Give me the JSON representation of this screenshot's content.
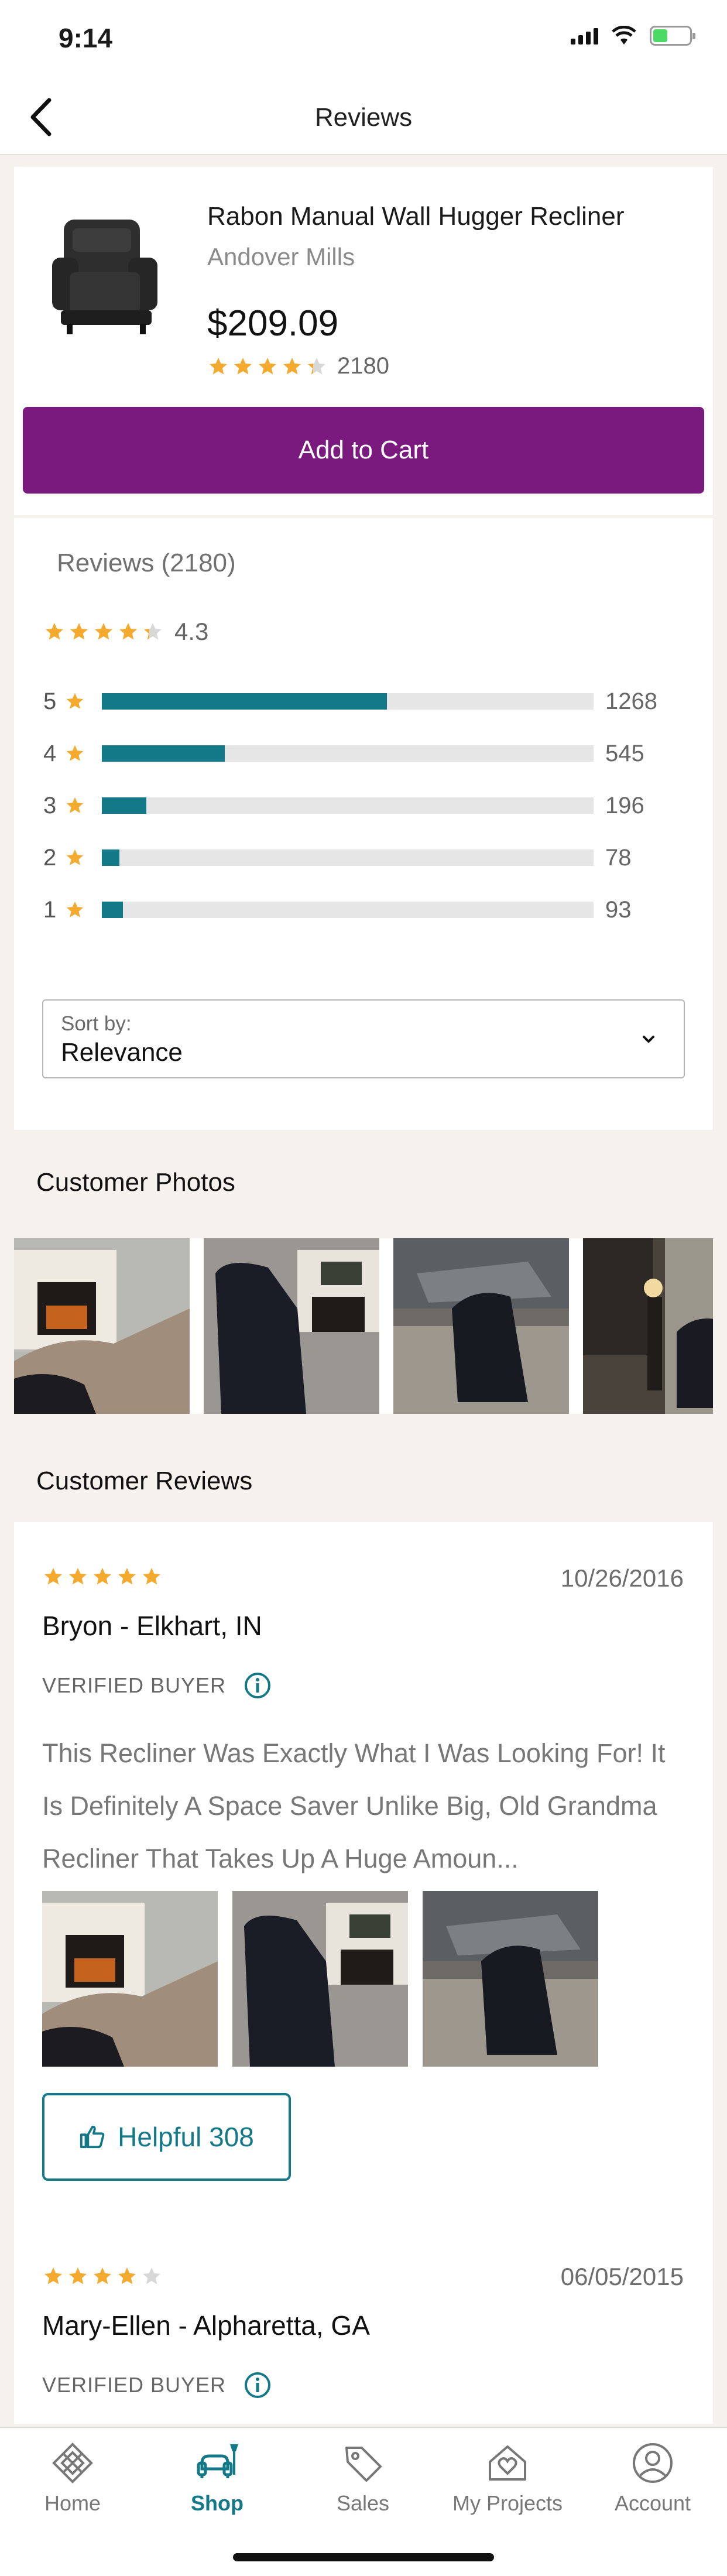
{
  "status_bar": {
    "time": "9:14"
  },
  "header": {
    "title": "Reviews"
  },
  "product": {
    "name": "Rabon Manual Wall Hugger Recliner",
    "brand": "Andover Mills",
    "price": "$209.09",
    "rating": 4.3,
    "review_count": "2180",
    "add_to_cart_label": "Add to Cart"
  },
  "summary": {
    "title": "Reviews (2180)",
    "average": "4.3",
    "distribution": [
      {
        "stars": "5",
        "count": "1268",
        "fraction": 0.58
      },
      {
        "stars": "4",
        "count": "545",
        "fraction": 0.25
      },
      {
        "stars": "3",
        "count": "196",
        "fraction": 0.09
      },
      {
        "stars": "2",
        "count": "78",
        "fraction": 0.036
      },
      {
        "stars": "1",
        "count": "93",
        "fraction": 0.043
      }
    ]
  },
  "sort": {
    "label": "Sort by:",
    "value": "Relevance"
  },
  "photos_section": {
    "title": "Customer Photos"
  },
  "reviews_section": {
    "title": "Customer Reviews"
  },
  "reviews": [
    {
      "rating": 5,
      "date": "10/26/2016",
      "author": "Bryon - Elkhart, IN",
      "verified": "VERIFIED BUYER",
      "text": "This Recliner Was Exactly What I Was Looking For! It Is Definitely A Space Saver Unlike Big, Old Grandma Recliner That Takes Up A Huge Amoun...",
      "helpful_label": "Helpful 308"
    },
    {
      "rating": 4,
      "date": "06/05/2015",
      "author": "Mary-Ellen - Alpharetta, GA",
      "verified": "VERIFIED BUYER"
    }
  ],
  "tabs": [
    {
      "label": "Home",
      "icon": "home-icon"
    },
    {
      "label": "Shop",
      "icon": "shop-icon",
      "active": true
    },
    {
      "label": "Sales",
      "icon": "sales-tag-icon"
    },
    {
      "label": "My Projects",
      "icon": "projects-icon"
    },
    {
      "label": "Account",
      "icon": "account-icon"
    }
  ],
  "colors": {
    "brand_purple": "#7b1a7e",
    "teal": "#137887",
    "star": "#f4a92f",
    "star_empty": "#d8d8d8"
  }
}
